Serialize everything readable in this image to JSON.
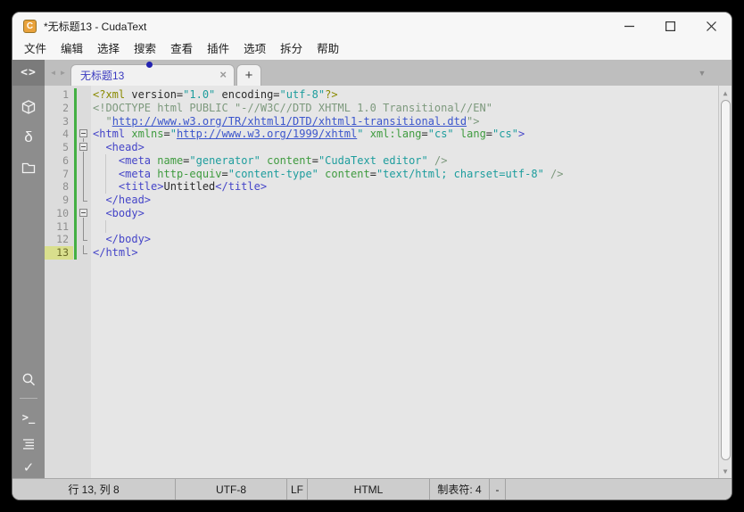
{
  "window": {
    "title": "*无标题13 - CudaText",
    "logo_letter": "C"
  },
  "menubar": {
    "items": [
      "文件",
      "编辑",
      "选择",
      "搜索",
      "查看",
      "插件",
      "选项",
      "拆分",
      "帮助"
    ]
  },
  "tabbar": {
    "prev_glyph": "◄",
    "next_glyph": "►",
    "tab_label": "无标题13",
    "close_glyph": "×",
    "new_tab_glyph": "+",
    "dropdown_glyph": "▼"
  },
  "sidebar": {
    "code_glyph": "<>",
    "delta_glyph": "δ",
    "console_glyph": ">_",
    "check_glyph": "✓"
  },
  "scrollbar": {
    "up_glyph": "▲",
    "down_glyph": "▼"
  },
  "editor": {
    "language": "HTML",
    "current_line": 13,
    "current_col": 8,
    "lines": [
      {
        "num": 1,
        "fold": "",
        "changed": true,
        "tokens": [
          [
            "<?xml",
            "pi"
          ],
          [
            " version=",
            "plain"
          ],
          [
            "\"1.0\"",
            "val"
          ],
          [
            " encoding=",
            "plain"
          ],
          [
            "\"utf-8\"",
            "val"
          ],
          [
            "?>",
            "pi"
          ]
        ]
      },
      {
        "num": 2,
        "fold": "",
        "changed": true,
        "tokens": [
          [
            "<!DOCTYPE html PUBLIC \"-//W3C//DTD XHTML 1.0 Transitional//EN\"",
            "doc"
          ]
        ]
      },
      {
        "num": 3,
        "fold": "",
        "changed": true,
        "tokens": [
          [
            "  \"",
            "doc"
          ],
          [
            "http://www.w3.org/TR/xhtml1/DTD/xhtml1-transitional.dtd",
            "url"
          ],
          [
            "\">",
            "doc"
          ]
        ]
      },
      {
        "num": 4,
        "fold": "start",
        "changed": true,
        "tokens": [
          [
            "<html",
            "tag"
          ],
          [
            " ",
            "plain"
          ],
          [
            "xmlns",
            "attr"
          ],
          [
            "=",
            "plain"
          ],
          [
            "\"",
            "val"
          ],
          [
            "http://www.w3.org/1999/xhtml",
            "url"
          ],
          [
            "\"",
            "val"
          ],
          [
            " ",
            "plain"
          ],
          [
            "xml:lang",
            "attr"
          ],
          [
            "=",
            "plain"
          ],
          [
            "\"cs\"",
            "val"
          ],
          [
            " ",
            "plain"
          ],
          [
            "lang",
            "attr"
          ],
          [
            "=",
            "plain"
          ],
          [
            "\"cs\"",
            "val"
          ],
          [
            ">",
            "tag"
          ]
        ]
      },
      {
        "num": 5,
        "fold": "start",
        "changed": true,
        "tokens": [
          [
            "  ",
            "plain"
          ],
          [
            "<head>",
            "tag"
          ]
        ]
      },
      {
        "num": 6,
        "fold": "mid",
        "changed": true,
        "tokens": [
          [
            "    ",
            "plain"
          ],
          [
            "<meta",
            "tag"
          ],
          [
            " ",
            "plain"
          ],
          [
            "name",
            "attr"
          ],
          [
            "=",
            "plain"
          ],
          [
            "\"generator\"",
            "val"
          ],
          [
            " ",
            "plain"
          ],
          [
            "content",
            "attr"
          ],
          [
            "=",
            "plain"
          ],
          [
            "\"CudaText editor\"",
            "val"
          ],
          [
            " />",
            "doc"
          ]
        ]
      },
      {
        "num": 7,
        "fold": "mid",
        "changed": true,
        "tokens": [
          [
            "    ",
            "plain"
          ],
          [
            "<meta",
            "tag"
          ],
          [
            " ",
            "plain"
          ],
          [
            "http-equiv",
            "attr"
          ],
          [
            "=",
            "plain"
          ],
          [
            "\"content-type\"",
            "val"
          ],
          [
            " ",
            "plain"
          ],
          [
            "content",
            "attr"
          ],
          [
            "=",
            "plain"
          ],
          [
            "\"text/html; charset=utf-8\"",
            "val"
          ],
          [
            " />",
            "doc"
          ]
        ]
      },
      {
        "num": 8,
        "fold": "mid",
        "changed": true,
        "tokens": [
          [
            "    ",
            "plain"
          ],
          [
            "<title>",
            "tag"
          ],
          [
            "Untitled",
            "plain"
          ],
          [
            "</title>",
            "tag"
          ]
        ]
      },
      {
        "num": 9,
        "fold": "end",
        "changed": true,
        "tokens": [
          [
            "  ",
            "plain"
          ],
          [
            "</head>",
            "tag"
          ]
        ]
      },
      {
        "num": 10,
        "fold": "start",
        "changed": true,
        "tokens": [
          [
            "  ",
            "plain"
          ],
          [
            "<body>",
            "tag"
          ]
        ]
      },
      {
        "num": 11,
        "fold": "mid",
        "changed": true,
        "tokens": []
      },
      {
        "num": 12,
        "fold": "end",
        "changed": true,
        "tokens": [
          [
            "  ",
            "plain"
          ],
          [
            "</body>",
            "tag"
          ]
        ]
      },
      {
        "num": 13,
        "fold": "end",
        "changed": true,
        "tokens": [
          [
            "</html>",
            "tag"
          ]
        ]
      }
    ]
  },
  "statusbar": {
    "cells": [
      "行 13, 列 8",
      "UTF-8",
      "LF",
      "HTML",
      "制表符: 4",
      "-"
    ]
  },
  "colors": {
    "syntax_tag": "#4545c8",
    "syntax_attr": "#3f9b3f",
    "syntax_value": "#1d9d9d",
    "syntax_pi": "#8a8a00",
    "syntax_doctype": "#7d997d",
    "syntax_link": "#3b55cc",
    "syntax_plain": "#2b2b2b",
    "modified_marker": "#44b044",
    "current_line_bg": "#d9df8d",
    "tab_text": "#3a3abf",
    "modified_dot": "#2222b0",
    "app_icon": "#e9a23b"
  }
}
